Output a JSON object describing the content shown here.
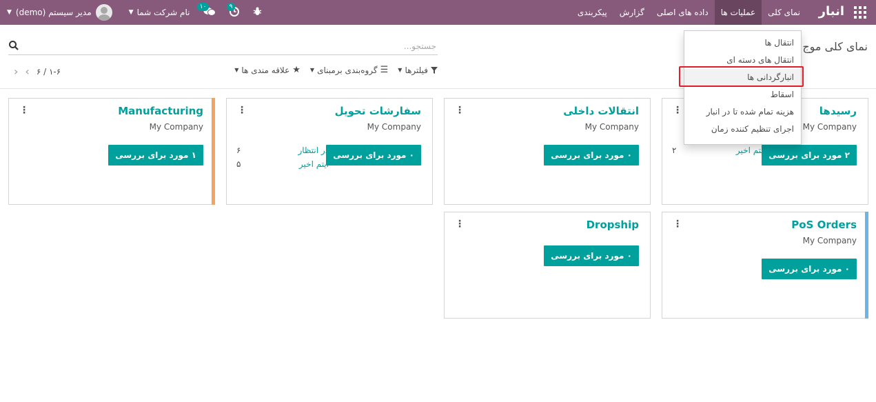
{
  "navbar": {
    "brand": "انبار",
    "menu": [
      "نمای کلی",
      "عملیات ها",
      "داده های اصلی",
      "گزارش",
      "پیکربندی"
    ],
    "user_name": "مدیر سیستم (demo)",
    "company_name": "نام شرکت شما",
    "messages_badge": "۱۰",
    "activities_badge": "۹"
  },
  "control": {
    "title": "نمای کلی موج",
    "search_placeholder": "جستجو...",
    "filters": "فیلترها",
    "group_by": "گروه‌بندی برمبنای",
    "favorites": "علاقه مندی ها",
    "pager": "۱-۶ / ۶"
  },
  "cards": [
    {
      "title": "رسیدها",
      "company": "My Company",
      "button": "۲ مورد برای بررسی",
      "stats": [
        {
          "label": "آیتم اخیر",
          "value": "۲"
        }
      ],
      "accent": ""
    },
    {
      "title": "انتقالات داخلی",
      "company": "My Company",
      "button": "۰ مورد برای بررسی",
      "stats": [],
      "accent": ""
    },
    {
      "title": "سفارشات تحویل",
      "company": "My Company",
      "button": "۰ مورد برای بررسی",
      "stats": [
        {
          "label": "در انتظار",
          "value": "۶"
        },
        {
          "label": "آیتم اخیر",
          "value": "۵"
        }
      ],
      "accent": ""
    },
    {
      "title": "Manufacturing",
      "company": "My Company",
      "button": "۱ مورد برای بررسی",
      "stats": [],
      "accent": "#f4a460"
    },
    {
      "title": "PoS Orders",
      "company": "My Company",
      "button": "۰ مورد برای بررسی",
      "stats": [],
      "accent": "#6cb6e6"
    },
    {
      "title": "Dropship",
      "company": "",
      "button": "۰ مورد برای بررسی",
      "stats": [],
      "accent": ""
    }
  ],
  "dropdown": {
    "items": [
      "انتقال ها",
      "انتقال های دسته ای",
      "انبارگردانی ها",
      "اسقاط",
      "هزینه تمام شده تا در انبار",
      "اجرای تنظیم کننده زمان"
    ]
  }
}
